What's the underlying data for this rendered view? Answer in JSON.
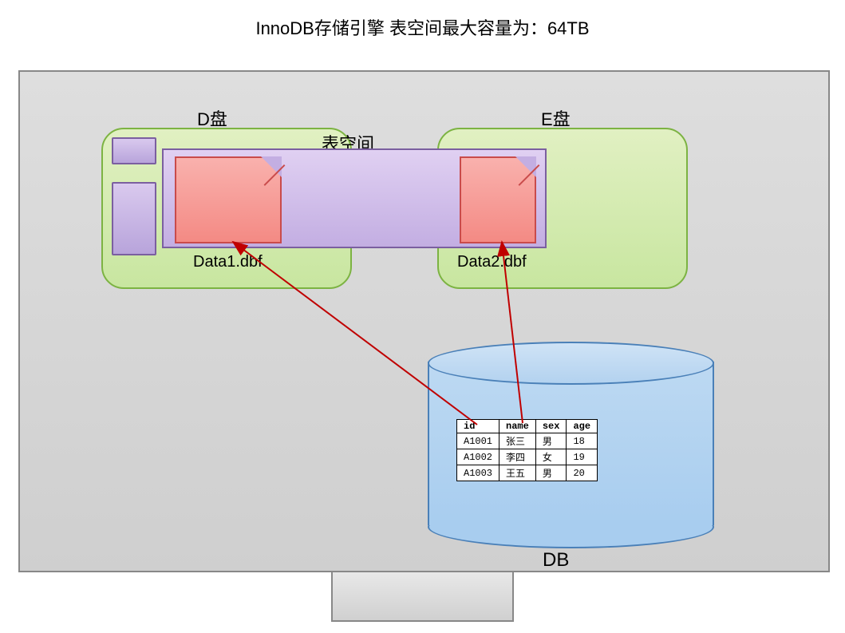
{
  "title": "InnoDB存储引擎 表空间最大容量为：64TB",
  "disks": {
    "d_label": "D盘",
    "e_label": "E盘"
  },
  "tablespace_label": "表空间",
  "datafiles": {
    "file1_label": "Data1.dbf",
    "file2_label": "Data2.dbf"
  },
  "db_label": "DB",
  "table": {
    "headers": {
      "c1": "id",
      "c2": "name",
      "c3": "sex",
      "c4": "age"
    },
    "rows": [
      {
        "c1": "A1001",
        "c2": "张三",
        "c3": "男",
        "c4": "18"
      },
      {
        "c1": "A1002",
        "c2": "李四",
        "c3": "女",
        "c4": "19"
      },
      {
        "c1": "A1003",
        "c2": "王五",
        "c3": "男",
        "c4": "20"
      }
    ]
  }
}
